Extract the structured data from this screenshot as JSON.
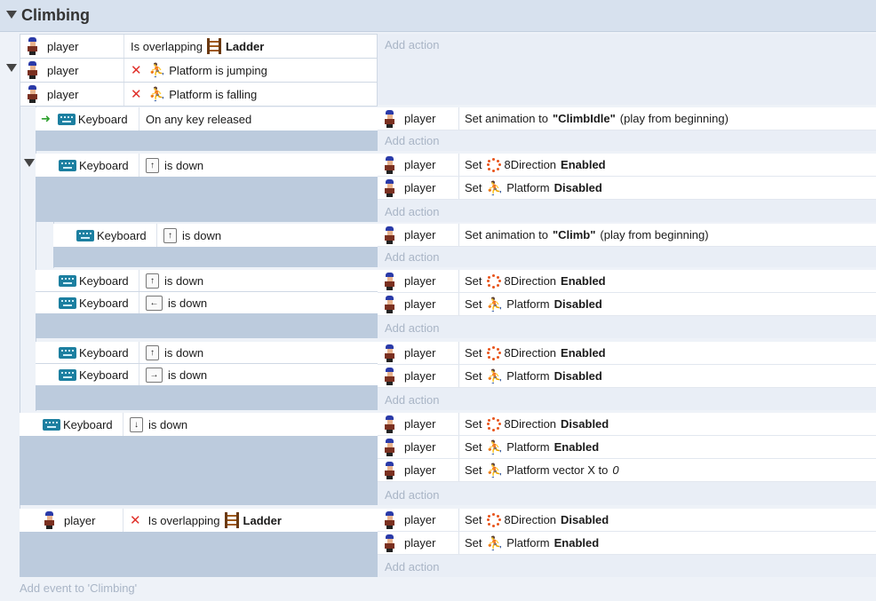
{
  "group": {
    "title": "Climbing",
    "add_event": "Add event to 'Climbing'"
  },
  "labels": {
    "player": "player",
    "keyboard": "Keyboard",
    "add_action": "Add action",
    "is_overlapping": "Is overlapping",
    "ladder": "Ladder",
    "platform_is_jumping": "Platform is jumping",
    "platform_is_falling": "Platform is falling",
    "on_any_key_released": "On any key released",
    "is_down": "is down",
    "set": "Set",
    "set_animation_to": "Set animation to",
    "play_from_beginning": "(play from beginning)",
    "direction8": "8Direction",
    "platform": "Platform",
    "enabled": "Enabled",
    "disabled": "Disabled",
    "platform_vector_x_to": "Platform vector X to",
    "zero": "0",
    "anim_climbidle": "\"ClimbIdle\"",
    "anim_climb": "\"Climb\""
  },
  "keys": {
    "up": "↑",
    "down": "↓",
    "left": "←",
    "right": "→"
  },
  "icons": {
    "player": "player-sprite-icon",
    "keyboard": "keyboard-icon",
    "ladder": "ladder-icon",
    "invert": "invert-x-icon",
    "platform": "platform-behavior-icon",
    "eight_direction": "eight-direction-icon",
    "trigger": "trigger-arrow-icon"
  },
  "colors": {
    "condition_bg": "#bccbdd",
    "action_bg": "#e9eef6",
    "header_bg": "#d7e1ee",
    "invert_red": "#e0302a",
    "behavior_orange": "#e85c1c",
    "keyboard_teal": "#1c7fa0"
  }
}
